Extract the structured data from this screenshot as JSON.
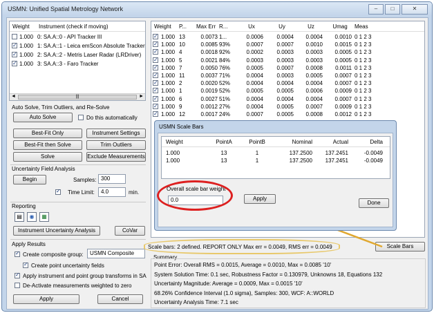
{
  "window": {
    "title": "USMN: Unified Spatial Metrology Network",
    "min": "–",
    "max": "□",
    "close": "✕"
  },
  "instruments": {
    "headers": [
      "Weight",
      "Instrument (check if moving)"
    ],
    "rows": [
      {
        "checked": false,
        "weight": "1.000",
        "name": "0: SA.A::0 - API Tracker III"
      },
      {
        "checked": true,
        "weight": "1.000",
        "name": "1: SA.A::1 - Leica emScon Absolute Tracker (AT"
      },
      {
        "checked": true,
        "weight": "1.000",
        "name": "2: SA.A::2 - Metris Laser Radar (LRDriver)"
      },
      {
        "checked": true,
        "weight": "1.000",
        "name": "3: SA.A::3 - Faro Tracker"
      }
    ],
    "scroll_left": "◄",
    "scroll_right": "►",
    "scroll_grip": "|||"
  },
  "auto_solve": {
    "heading": "Auto Solve, Trim Outliers, and Re-Solve",
    "button": "Auto Solve",
    "do_auto_label": "Do this automatically",
    "do_auto_checked": false
  },
  "buttons": {
    "best_fit_only": "Best-Fit Only",
    "instrument_settings": "Instrument Settings",
    "best_fit_then_solve": "Best-Fit then Solve",
    "trim_outliers": "Trim Outliers",
    "solve": "Solve",
    "exclude_measurements": "Exclude Measurements"
  },
  "uncertainty": {
    "heading": "Uncertainty Field Analysis",
    "begin": "Begin",
    "samples_label": "Samples:",
    "samples_value": "300",
    "time_limit_label": "Time Limit:",
    "time_limit_checked": true,
    "time_limit_value": "4.0",
    "time_limit_unit": "min."
  },
  "reporting": {
    "heading": "Reporting",
    "analysis_button": "Instrument Uncertainty Analysis",
    "covar_button": "CoVar"
  },
  "apply_results": {
    "heading": "Apply Results",
    "create_group_label": "Create composite group:",
    "create_group_checked": true,
    "group_name": "USMN Composite",
    "point_fields_label": "Create point uncertainty fields",
    "point_fields_checked": true,
    "apply_transforms_label": "Apply instrument and point group transforms in SA",
    "apply_transforms_checked": true,
    "deactivate_label": "De-Activate measurements weighted to zero",
    "deactivate_checked": false,
    "apply": "Apply",
    "cancel": "Cancel"
  },
  "points_table": {
    "headers": [
      "Weight",
      "P...",
      "Max Err",
      "R...",
      "Ux",
      "Uy",
      "Uz",
      "Umag",
      "Meas"
    ],
    "rows": [
      [
        "1.000",
        "13",
        "0.0073",
        "1...",
        "0.0006",
        "0.0004",
        "0.0004",
        "0.0010",
        "0 1 2 3"
      ],
      [
        "1.000",
        "10",
        "0.0085",
        "93%",
        "0.0007",
        "0.0007",
        "0.0010",
        "0.0015",
        "0 1 2 3"
      ],
      [
        "1.000",
        "4",
        "0.0018",
        "92%",
        "0.0002",
        "0.0003",
        "0.0003",
        "0.0005",
        "0 1 2 3"
      ],
      [
        "1.000",
        "5",
        "0.0021",
        "84%",
        "0.0003",
        "0.0003",
        "0.0003",
        "0.0005",
        "0 1 2 3"
      ],
      [
        "1.000",
        "7",
        "0.0050",
        "76%",
        "0.0005",
        "0.0007",
        "0.0008",
        "0.0011",
        "0 1 2 3"
      ],
      [
        "1.000",
        "11",
        "0.0037",
        "71%",
        "0.0004",
        "0.0003",
        "0.0005",
        "0.0007",
        "0 1 2 3"
      ],
      [
        "1.000",
        "2",
        "0.0020",
        "52%",
        "0.0004",
        "0.0004",
        "0.0004",
        "0.0007",
        "0 1 2 3"
      ],
      [
        "1.000",
        "1",
        "0.0019",
        "52%",
        "0.0005",
        "0.0005",
        "0.0006",
        "0.0009",
        "0 1 2 3"
      ],
      [
        "1.000",
        "6",
        "0.0027",
        "51%",
        "0.0004",
        "0.0004",
        "0.0004",
        "0.0007",
        "0 1 2 3"
      ],
      [
        "1.000",
        "9",
        "0.0012",
        "27%",
        "0.0004",
        "0.0005",
        "0.0007",
        "0.0009",
        "0 1 2 3"
      ],
      [
        "1.000",
        "12",
        "0.0017",
        "24%",
        "0.0007",
        "0.0005",
        "0.0008",
        "0.0012",
        "0 1 2 3"
      ]
    ]
  },
  "scale_bars_dialog": {
    "title": "USMN Scale Bars",
    "headers": [
      "Weight",
      "PointA",
      "PointB",
      "Nominal",
      "Actual",
      "Delta"
    ],
    "rows": [
      [
        "1.000",
        "13",
        "1",
        "137.2500",
        "137.2451",
        "-0.0049"
      ],
      [
        "1.000",
        "13",
        "1",
        "137.2500",
        "137.2451",
        "-0.0049"
      ]
    ],
    "overall_label": "Overall scale bar weight",
    "overall_value": "0.0",
    "apply": "Apply",
    "done": "Done"
  },
  "scale_bars_status": "Scale bars:  2 defined. REPORT ONLY  Max err = 0.0049, RMS err = 0.0049",
  "scale_bars_button": "Scale Bars",
  "summary": {
    "heading": "Summary",
    "lines": [
      "Point Error: Overall RMS = 0.0015, Average = 0.0010, Max = 0.0085 '10'",
      "System Solution Time: 0.1 sec,  Robustness Factor = 0.130979,  Unknowns 18, Equations 132",
      "Uncertainty Magnitude:  Average = 0.0009, Max = 0.0015 '10'",
      "68.26% Confidence Interval (1.0 sigma), Samples: 300, WCF: A::WORLD",
      "Uncertainty Analysis Time: 7.1 sec"
    ]
  },
  "colors": {
    "annotation_red": "#dd2020",
    "annotation_gold": "#e0a830",
    "window_frame": "#c3d5ea"
  }
}
